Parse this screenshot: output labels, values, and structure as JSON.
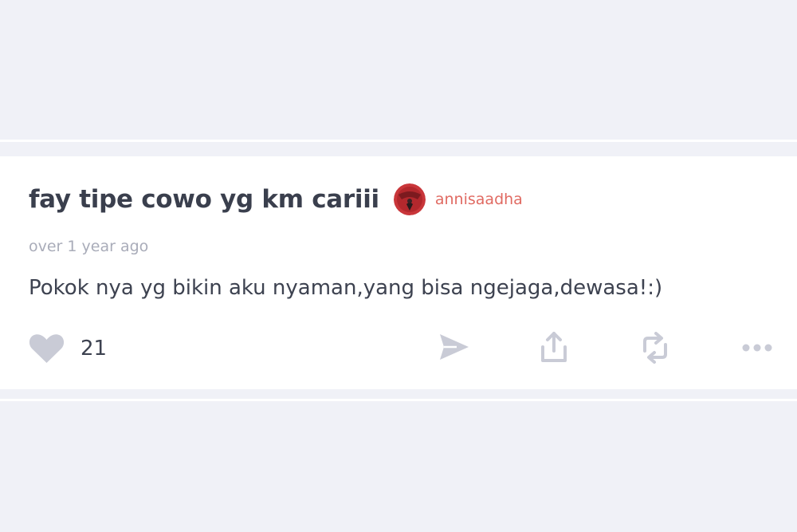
{
  "post": {
    "title": "fay tipe cowo yg km cariii",
    "author": "annisaadha",
    "timestamp": "over 1 year ago",
    "body": "Pokok nya yg bikin aku nyaman,yang bisa ngejaga,dewasa!:)",
    "likes": "21"
  },
  "icons": {
    "like": "heart-icon",
    "send": "send-icon",
    "share": "share-icon",
    "repost": "repost-icon",
    "more": "more-icon"
  },
  "colors": {
    "background": "#f0f1f7",
    "card": "#ffffff",
    "title": "#3a3f4d",
    "author": "#e06a62",
    "muted": "#a9acb9",
    "icon": "#c9cbd6"
  }
}
